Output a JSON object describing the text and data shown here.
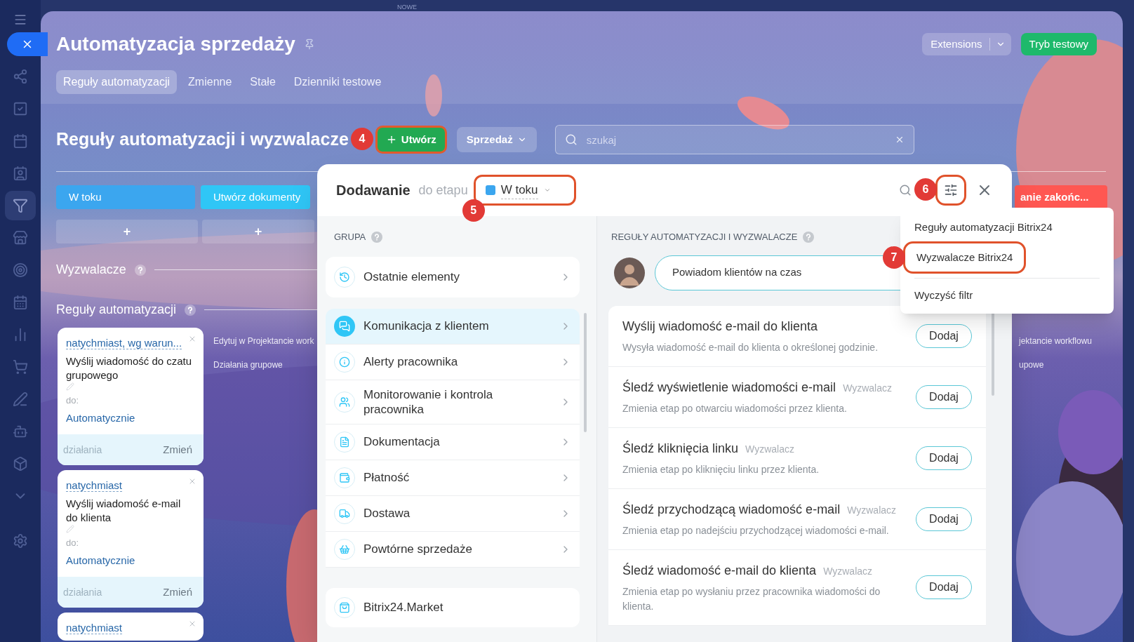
{
  "top_strip": {
    "label": "NOWE"
  },
  "sidebar": {
    "items": [
      {
        "selected": false
      },
      {
        "selected": false
      },
      {
        "selected": false
      },
      {
        "selected": false
      },
      {
        "selected": true
      },
      {
        "selected": false
      },
      {
        "selected": false
      },
      {
        "selected": false
      },
      {
        "selected": false
      },
      {
        "selected": false
      },
      {
        "selected": false
      },
      {
        "selected": false
      },
      {
        "selected": false
      },
      {
        "selected": false
      },
      {
        "selected": false
      }
    ]
  },
  "header": {
    "title": "Automatyzacja sprzedaży",
    "tabs": [
      {
        "label": "Reguły automatyzacji",
        "selected": true
      },
      {
        "label": "Zmienne",
        "selected": false
      },
      {
        "label": "Stałe",
        "selected": false
      },
      {
        "label": "Dzienniki testowe",
        "selected": false
      }
    ],
    "extensions_button": "Extensions",
    "test_mode_button": "Tryb testowy"
  },
  "section": {
    "title": "Reguły automatyzacji i wyzwalacze",
    "create_button": {
      "label": "Utwórz",
      "callout": "4"
    },
    "pipeline_select": "Sprzedaż",
    "search": {
      "placeholder": "szukaj"
    }
  },
  "stages": [
    {
      "label": "W toku",
      "color": "#3ba6ef"
    },
    {
      "label": "Utwórz dokumenty",
      "color": "#2fc6f6"
    },
    {
      "label": "anie zakońc...",
      "color": "#ff5752"
    }
  ],
  "add_rows": [
    "+",
    "+"
  ],
  "triggers_heading": "Wyzwalacze",
  "rules_heading": "Reguły automatyzacji",
  "rule_cards": [
    {
      "condition": "natychmiast, wg warun...",
      "title": "Wyślij wiadomość do czatu grupowego",
      "to_label": "do:",
      "to_value": "Automatycznie",
      "actions_label": "działania",
      "change_link": "Zmień"
    },
    {
      "condition": "natychmiast",
      "title": "Wyślij wiadomość e-mail do klienta",
      "to_label": "do:",
      "to_value": "Automatycznie",
      "actions_label": "działania",
      "change_link": "Zmień"
    },
    {
      "condition": "natychmiast"
    }
  ],
  "column_links": [
    "Edytuj w Projektancie work",
    "Działania grupowe"
  ],
  "right_column_links": [
    "jektancie workflowu",
    "upowe"
  ],
  "modal": {
    "title": "Dodawanie",
    "stage_prefix": "do etapu",
    "stage_select": {
      "label": "W toku",
      "color": "#3ba6ef",
      "callout": "5"
    },
    "filter_callout": "6",
    "group_heading": "GRUPA",
    "recent": "Ostatnie elementy",
    "groups": [
      {
        "label": "Komunikacja z klientem",
        "selected": true
      },
      {
        "label": "Alerty pracownika",
        "selected": false
      },
      {
        "label": "Monitorowanie i kontrola pracownika",
        "selected": false
      },
      {
        "label": "Dokumentacja",
        "selected": false
      },
      {
        "label": "Płatność",
        "selected": false
      },
      {
        "label": "Dostawa",
        "selected": false
      },
      {
        "label": "Powtórne sprzedaże",
        "selected": false
      }
    ],
    "market": "Bitrix24.Market",
    "rules_heading": "REGUŁY AUTOMATYZACJI I WYZWALACZE",
    "promo": "Powiadom klientów na czas",
    "rules": [
      {
        "title": "Wyślij wiadomość e-mail do klienta",
        "description": "Wysyła wiadomość e-mail do klienta o określonej godzinie.",
        "button": "Dodaj"
      },
      {
        "title": "Śledź wyświetlenie wiadomości e-mail",
        "tag": "Wyzwalacz",
        "description": "Zmienia etap po otwarciu wiadomości przez klienta.",
        "button": "Dodaj"
      },
      {
        "title": "Śledź kliknięcia linku",
        "tag": "Wyzwalacz",
        "description": "Zmienia etap po kliknięciu linku przez klienta.",
        "button": "Dodaj"
      },
      {
        "title": "Śledź przychodzącą wiadomość e-mail",
        "tag": "Wyzwalacz",
        "description": "Zmienia etap po nadejściu przychodzącej wiadomości e-mail.",
        "button": "Dodaj"
      },
      {
        "title": "Śledź wiadomość e-mail do klienta",
        "tag": "Wyzwalacz",
        "description": "Zmienia etap po wysłaniu przez pracownika wiadomości do klienta.",
        "button": "Dodaj"
      }
    ]
  },
  "filter_menu": {
    "options": [
      {
        "label": "Reguły automatyzacji Bitrix24"
      },
      {
        "label": "Wyzwalacze Bitrix24",
        "callout": "7"
      }
    ],
    "clear": "Wyczyść filtr"
  }
}
